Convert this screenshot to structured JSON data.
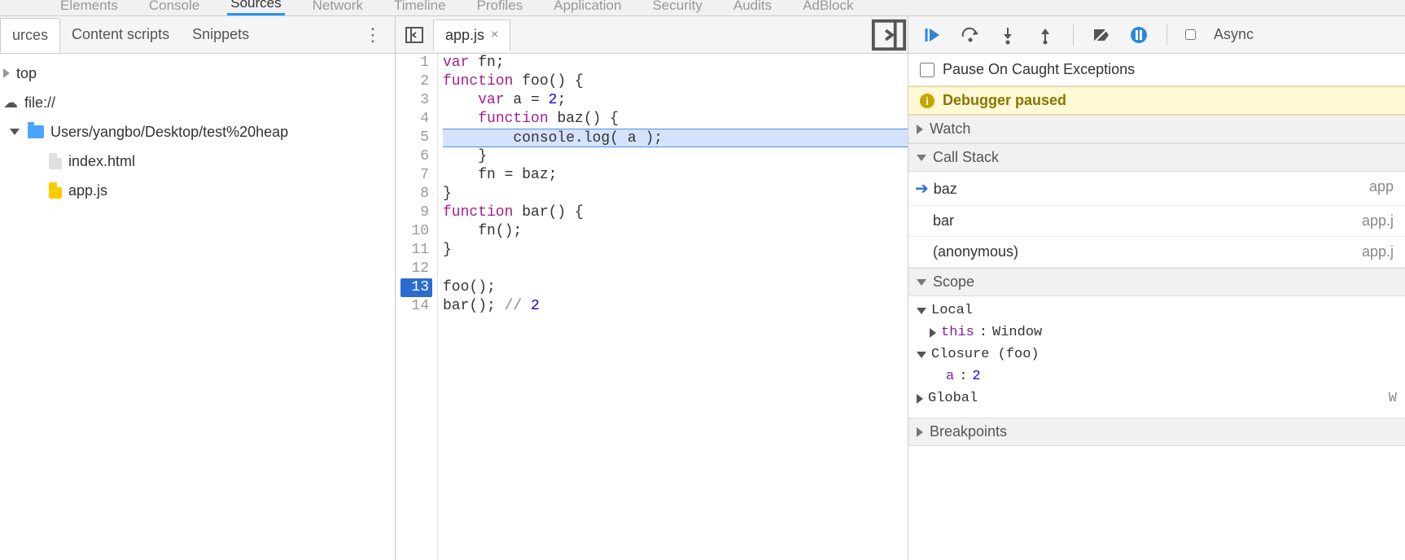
{
  "top_tabs": {
    "elements": "Elements",
    "console": "Console",
    "sources": "Sources",
    "network": "Network",
    "timeline": "Timeline",
    "profiles": "Profiles",
    "application": "Application",
    "security": "Security",
    "audits": "Audits",
    "adblock": "AdBlock"
  },
  "left": {
    "tabs": {
      "sources": "urces",
      "content_scripts": "Content scripts",
      "snippets": "Snippets"
    },
    "tree": {
      "top": "top",
      "file_scheme": "file://",
      "folder_path": "Users/yangbo/Desktop/test%20heap",
      "file_index": "index.html",
      "file_app": "app.js"
    }
  },
  "center": {
    "active_file": "app.js",
    "lines": [
      "var fn;",
      "function foo() {",
      "    var a = 2;",
      "    function baz() {",
      "        console.log( a );",
      "    }",
      "    fn = baz;",
      "}",
      "function bar() {",
      "    fn();",
      "}",
      "",
      "foo();",
      "bar(); // 2"
    ],
    "highlight_line": 5,
    "breakpoint_line": 13
  },
  "right": {
    "async_label": "Async",
    "exceptions_label": "Pause On Caught Exceptions",
    "paused_label": "Debugger paused",
    "sections": {
      "watch": "Watch",
      "call_stack": "Call Stack",
      "scope": "Scope",
      "breakpoints": "Breakpoints"
    },
    "call_stack": [
      {
        "name": "baz",
        "src": "app",
        "current": true
      },
      {
        "name": "bar",
        "src": "app.j",
        "current": false
      },
      {
        "name": "(anonymous)",
        "src": "app.j",
        "current": false
      }
    ],
    "scope": {
      "local_label": "Local",
      "this_key": "this",
      "this_val": "Window",
      "closure_label": "Closure (foo)",
      "closure_var_key": "a",
      "closure_var_val": "2",
      "global_label": "Global",
      "global_val": "W"
    }
  }
}
